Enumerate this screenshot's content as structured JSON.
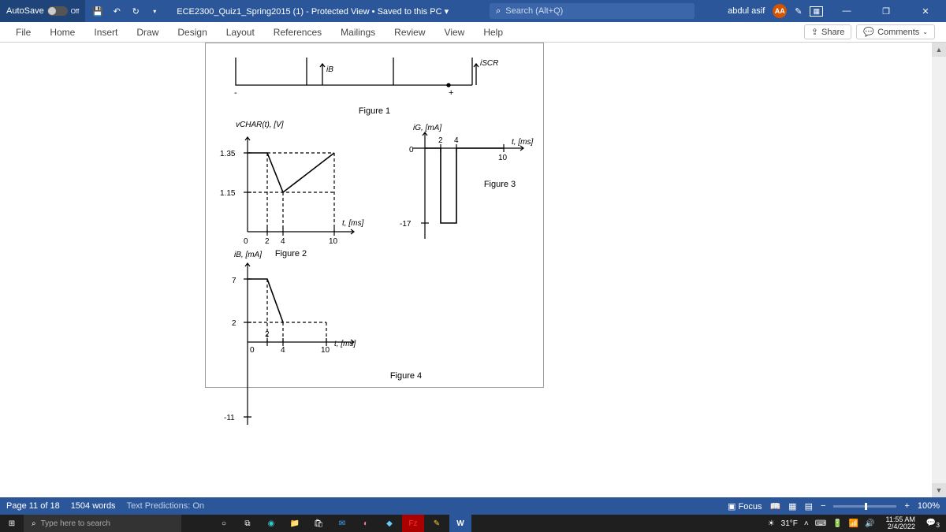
{
  "titlebar": {
    "autosave_label": "AutoSave",
    "autosave_state": "Off",
    "doc_title": "ECE2300_Quiz1_Spring2015 (1) - Protected View • Saved to this PC ▾",
    "search_placeholder": "Search (Alt+Q)",
    "user_name": "abdul asif",
    "user_initials": "AA"
  },
  "ribbon": {
    "tabs": [
      "File",
      "Home",
      "Insert",
      "Draw",
      "Design",
      "Layout",
      "References",
      "Mailings",
      "Review",
      "View",
      "Help"
    ],
    "share": "Share",
    "comments": "Comments"
  },
  "document": {
    "fig1_caption": "Figure 1",
    "fig1_iB": "iB",
    "fig1_iSCR": "iSCR",
    "fig1_plus": "+",
    "fig1_minus": "-",
    "fig2_ylabel": "vCHAR(t), [V]",
    "fig2_xlabel": "t, [ms]",
    "fig2_caption": "Figure 2",
    "fig2_y1": "1.35",
    "fig2_y2": "1.15",
    "fig2_x0": "0",
    "fig2_x2": "2",
    "fig2_x4": "4",
    "fig2_x10": "10",
    "fig3_ylabel": "iG, [mA]",
    "fig3_xlabel": "t, [ms]",
    "fig3_caption": "Figure 3",
    "fig3_y0": "0",
    "fig3_ym17": "-17",
    "fig3_x2": "2",
    "fig3_x4": "4",
    "fig3_x10": "10",
    "fig4_ylabel": "iB, [mA]",
    "fig4_xlabel": "t, [ms]",
    "fig4_caption": "Figure 4",
    "fig4_y7": "7",
    "fig4_y2": "2",
    "fig4_ym11": "-11",
    "fig4_x0": "0",
    "fig4_x2": "2",
    "fig4_x4": "4",
    "fig4_x10": "10"
  },
  "statusbar": {
    "page": "Page 11 of 18",
    "words": "1504 words",
    "predictions": "Text Predictions: On",
    "focus": "Focus",
    "zoom": "100%"
  },
  "taskbar": {
    "search_placeholder": "Type here to search",
    "weather": "31°F",
    "time": "11:55 AM",
    "date": "2/4/2022",
    "notif_count": "3"
  },
  "chart_data": [
    {
      "type": "line",
      "name": "Figure 2",
      "ylabel": "vCHAR(t) [V]",
      "xlabel": "t [ms]",
      "x": [
        0,
        2,
        4,
        10
      ],
      "y": [
        1.35,
        1.35,
        1.15,
        1.35
      ],
      "y_ticks": [
        1.15,
        1.35
      ],
      "x_ticks": [
        0,
        2,
        4,
        10
      ]
    },
    {
      "type": "line",
      "name": "Figure 3",
      "ylabel": "iG [mA]",
      "xlabel": "t [ms]",
      "x": [
        0,
        2,
        2,
        4,
        4,
        10
      ],
      "y": [
        0,
        0,
        -17,
        -17,
        0,
        0
      ],
      "y_ticks": [
        -17,
        0
      ],
      "x_ticks": [
        2,
        4,
        10
      ]
    },
    {
      "type": "line",
      "name": "Figure 4",
      "ylabel": "iB [mA]",
      "xlabel": "t [ms]",
      "x_ticks": [
        0,
        2,
        4,
        10
      ],
      "y_ticks": [
        -11,
        2,
        7
      ],
      "segments": [
        {
          "x": [
            0,
            2,
            4
          ],
          "y": [
            7,
            7,
            2
          ]
        }
      ],
      "ylim": [
        -11,
        7
      ]
    }
  ]
}
